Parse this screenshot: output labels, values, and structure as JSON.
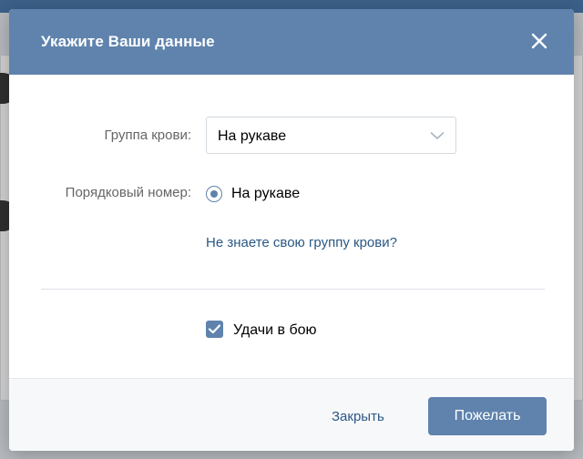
{
  "dialog": {
    "title": "Укажите Ваши данные"
  },
  "form": {
    "blood_group_label": "Группа крови:",
    "blood_group_value": "На рукаве",
    "serial_number_label": "Порядковый номер:",
    "serial_number_option": "На рукаве",
    "help_link": "Не знаете свою группу крови?",
    "checkbox_label": "Удачи в бою"
  },
  "footer": {
    "close_label": "Закрыть",
    "submit_label": "Пожелать"
  },
  "colors": {
    "header": "#5f83ad",
    "link": "#2a5885",
    "accent": "#5f83ad"
  },
  "icons": {
    "close": "close-icon",
    "dropdown": "chevron-down-icon",
    "check": "checkmark-icon"
  }
}
